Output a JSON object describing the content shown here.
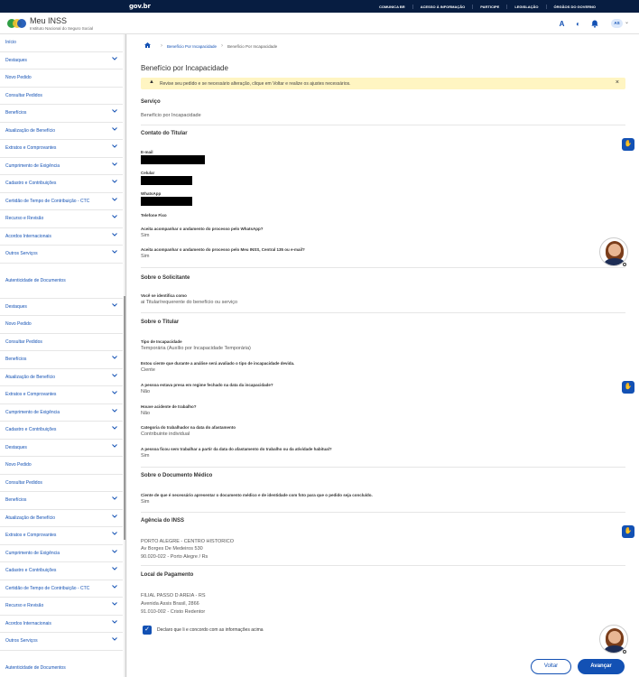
{
  "govbar": {
    "logo": "gov.br",
    "links": [
      "COMUNICA BR",
      "ACESSO À INFORMAÇÃO",
      "PARTICIPE",
      "LEGISLAÇÃO",
      "ÓRGÃOS DO GOVERNO"
    ]
  },
  "header": {
    "title": "Meu INSS",
    "subtitle": "Instituto Nacional do Seguro Social",
    "contrast_icon": "A",
    "user_initials": "AS",
    "colors": {
      "brand": "#1351b4",
      "govbar": "#071d41"
    }
  },
  "sidebar": {
    "items": [
      {
        "label": "Início",
        "expandable": false
      },
      {
        "label": "Destaques",
        "expandable": true
      },
      {
        "label": "Novo Pedido",
        "expandable": false
      },
      {
        "label": "Consultar Pedidos",
        "expandable": false
      },
      {
        "label": "Benefícios",
        "expandable": true
      },
      {
        "label": "Atualização de Benefício",
        "expandable": true
      },
      {
        "label": "Extratos e Comprovantes",
        "expandable": true
      },
      {
        "label": "Cumprimento de Exigência",
        "expandable": true
      },
      {
        "label": "Cadastro e Contribuições",
        "expandable": true
      },
      {
        "label": "Certidão de Tempo de Contribuição - CTC",
        "expandable": true
      },
      {
        "label": "Recurso e Revisão",
        "expandable": true
      },
      {
        "label": "Acordos Internacionais",
        "expandable": true
      },
      {
        "label": "Outros Serviços",
        "expandable": true
      },
      {
        "label": "Autenticidade de Documentos",
        "expandable": false,
        "tall": true
      },
      {
        "label": "Destaques",
        "expandable": true
      },
      {
        "label": "Novo Pedido",
        "expandable": false
      },
      {
        "label": "Consultar Pedidos",
        "expandable": false
      },
      {
        "label": "Benefícios",
        "expandable": true
      },
      {
        "label": "Atualização de Benefício",
        "expandable": true
      },
      {
        "label": "Extratos e Comprovantes",
        "expandable": true
      },
      {
        "label": "Cumprimento de Exigência",
        "expandable": true
      },
      {
        "label": "Cadastro e Contribuições",
        "expandable": true
      },
      {
        "label": "Destaques",
        "expandable": true
      },
      {
        "label": "Novo Pedido",
        "expandable": false
      },
      {
        "label": "Consultar Pedidos",
        "expandable": false
      },
      {
        "label": "Benefícios",
        "expandable": true
      },
      {
        "label": "Atualização de Benefício",
        "expandable": true
      },
      {
        "label": "Extratos e Comprovantes",
        "expandable": true
      },
      {
        "label": "Cumprimento de Exigência",
        "expandable": true
      },
      {
        "label": "Cadastro e Contribuições",
        "expandable": true
      },
      {
        "label": "Certidão de Tempo de Contribuição - CTC",
        "expandable": true
      },
      {
        "label": "Recurso e Revisão",
        "expandable": true
      },
      {
        "label": "Acordos Internacionais",
        "expandable": true
      },
      {
        "label": "Outros Serviços",
        "expandable": true
      },
      {
        "label": "Autenticidade de Documentos",
        "expandable": false,
        "tall": true
      }
    ]
  },
  "breadcrumb": {
    "items": [
      "Benefício Por Incapacidade",
      "Benefício Por Incapacidade"
    ]
  },
  "main": {
    "title": "Benefício por Incapacidade",
    "alert": "Revise seu pedido e se necessário alteração, clique em Voltar e realize os ajustes necessários.",
    "service": {
      "title": "Serviço",
      "value": "Benefício por Incapacidade"
    },
    "contact": {
      "title": "Contato do Titular",
      "email_label": "E-mail",
      "cell_label": "Celular",
      "whatsapp_label": "WhatsApp",
      "phone_label": "Telefone Fixo",
      "q_whatsapp": "Aceita acompanhar o andamento do processo pelo WhatsApp?",
      "a_whatsapp": "Sim",
      "q_channels": "Aceita acompanhar o andamento do processo pelo Meu INSS, Central 135 ou e-mail?",
      "a_channels": "Sim"
    },
    "requester": {
      "title": "Sobre o Solicitante",
      "q": "Você se identifica como",
      "a": "ai Titular/requerente do benefício ou serviço"
    },
    "holder": {
      "title": "Sobre o Titular",
      "fields": [
        {
          "label": "Tipo de Incapacidade",
          "value": "Temporária (Auxílio por Incapacidade Temporária)"
        },
        {
          "label": "Estou ciente que durante a análise será avaliado o tipo de incapacidade devida.",
          "value": "Ciente"
        },
        {
          "label": "A pessoa estava presa em regime fechado na data da incapacidade?",
          "value": "Não"
        },
        {
          "label": "Houve acidente de trabalho?",
          "value": "Não"
        },
        {
          "label": "Categoria do trabalhador na data do afastamento",
          "value": "Contribuinte individual"
        },
        {
          "label": "A pessoa ficou sem trabalhar a partir da data do afastamento do trabalho ou da atividade habitual?",
          "value": "Sim"
        }
      ]
    },
    "medical": {
      "title": "Sobre o Documento Médico",
      "q": "Ciente de que é necessário apresentar o documento médico e de identidade com foto para que o pedido seja concluído.",
      "a": "Sim"
    },
    "agency": {
      "title": "Agência do INSS",
      "lines": [
        "PORTO ALEGRE - CENTRO HISTORICO",
        "Av Borges De Medeiros 530",
        "90.020-022 - Porto Alegre / Rs"
      ]
    },
    "payment": {
      "title": "Local de Pagamento",
      "lines": [
        "FILIAL PASSO D AREIA - RS",
        "Avenida Assis Brasil, 2866",
        "91.010-002 - Cristo Redentor"
      ]
    },
    "declaration": "Declaro que li e concordo com as informações acima",
    "back_label": "Voltar",
    "next_label": "Avançar"
  }
}
